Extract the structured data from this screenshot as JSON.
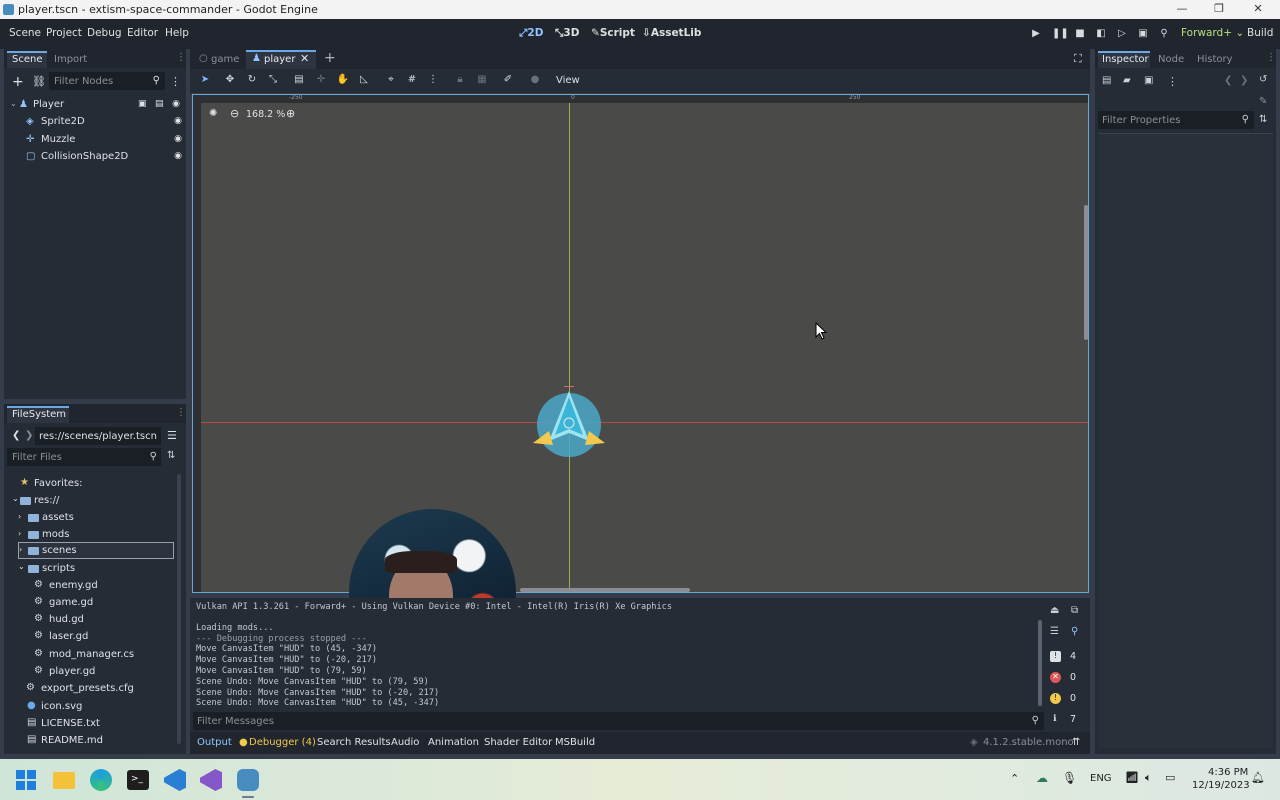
{
  "window": {
    "title": "player.tscn - extism-space-commander - Godot Engine"
  },
  "menu": {
    "items": [
      "Scene",
      "Project",
      "Debug",
      "Editor",
      "Help"
    ]
  },
  "workspaces": {
    "d2": "2D",
    "d3": "3D",
    "script": "Script",
    "assetlib": "AssetLib"
  },
  "renderer": {
    "label": "Forward+",
    "build": "Build"
  },
  "scene_dock": {
    "tab_scene": "Scene",
    "tab_import": "Import",
    "filter_placeholder": "Filter Nodes",
    "nodes": [
      "Player",
      "Sprite2D",
      "Muzzle",
      "CollisionShape2D"
    ]
  },
  "filesystem": {
    "tab": "FileSystem",
    "path": "res://scenes/player.tscn",
    "filter_placeholder": "Filter Files",
    "favorites": "Favorites:",
    "root": "res://",
    "folders": [
      "assets",
      "mods",
      "scenes",
      "scripts"
    ],
    "scripts": [
      "enemy.gd",
      "game.gd",
      "hud.gd",
      "laser.gd",
      "mod_manager.cs",
      "player.gd"
    ],
    "root_files": [
      "export_presets.cfg",
      "icon.svg",
      "LICENSE.txt",
      "README.md"
    ]
  },
  "editor_tabs": {
    "tab1": "game",
    "tab2": "player"
  },
  "toolbar": {
    "view": "View"
  },
  "viewport": {
    "zoom": "168.2 %",
    "ruler_neg": "-250",
    "ruler_zero": "0",
    "ruler_pos": "250"
  },
  "output": {
    "header": "Vulkan API 1.3.261 - Forward+ - Using Vulkan Device #0: Intel - Intel(R) Iris(R) Xe Graphics",
    "lines": [
      "Loading mods...",
      "--- Debugging process stopped ---",
      "Move CanvasItem \"HUD\" to (45, -347)",
      "Move CanvasItem \"HUD\" to (-20, 217)",
      "Move CanvasItem \"HUD\" to (79, 59)",
      "Scene Undo: Move CanvasItem \"HUD\" to (79, 59)",
      "Scene Undo: Move CanvasItem \"HUD\" to (-20, 217)",
      "Scene Undo: Move CanvasItem \"HUD\" to (45, -347)"
    ],
    "filter_placeholder": "Filter Messages",
    "counts": {
      "messages": "4",
      "errors": "0",
      "warnings": "0",
      "info": "7"
    }
  },
  "bottom_tabs": [
    "Output",
    "Debugger (4)",
    "Search Results",
    "Audio",
    "Animation",
    "Shader Editor",
    "MSBuild"
  ],
  "version": "4.1.2.stable.mono",
  "inspector": {
    "tabs": [
      "Inspector",
      "Node",
      "History"
    ],
    "filter_placeholder": "Filter Properties"
  },
  "taskbar": {
    "lang": "ENG",
    "time": "4:36 PM",
    "date": "12/19/2023"
  },
  "colors": {
    "accent": "#8fc4ff",
    "panel": "#262c35",
    "base": "#21262e",
    "viewport": "#4a4a49"
  }
}
